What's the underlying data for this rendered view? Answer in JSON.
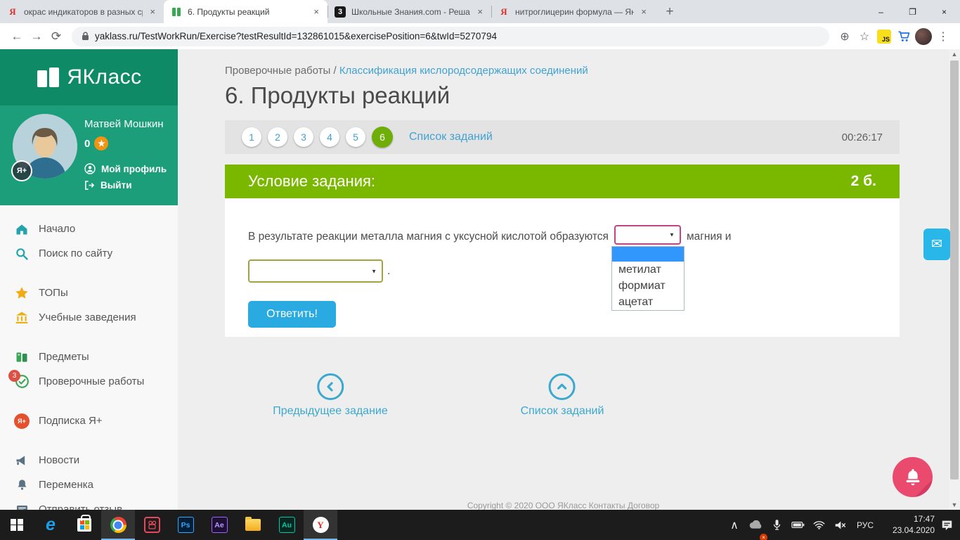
{
  "colors": {
    "sidebar_teal_dark": "#0e8a66",
    "sidebar_teal": "#1b9e79",
    "task_green": "#7ab800",
    "active_circle_green": "#6fae08",
    "link_blue": "#41a2d2",
    "button_blue": "#29abe2",
    "select1_border": "#c2457f",
    "select2_border": "#a2a43c",
    "dropdown_highlight": "#3297fd",
    "bell_pink": "#e94a6e",
    "mail_widget_blue": "#29b6e8",
    "badge_red": "#dd5145",
    "yaplus_red": "#e4512e"
  },
  "browser": {
    "tabs": [
      {
        "title": "окрас индикаторов в разных ср",
        "favicon_glyph": "Я"
      },
      {
        "title": "6. Продукты реакций",
        "favicon_glyph": ""
      },
      {
        "title": "Школьные Знания.com - Решае",
        "favicon_glyph": "3"
      },
      {
        "title": "нитроглицерин формула — Янд",
        "favicon_glyph": "Я"
      }
    ],
    "close_glyph": "×",
    "new_tab_glyph": "+",
    "window_controls": {
      "minimize": "–",
      "maximize": "❐",
      "close": "×"
    },
    "toolbar": {
      "back_glyph": "←",
      "forward_glyph": "→",
      "reload_glyph": "⟳",
      "url": "yaklass.ru/TestWorkRun/Exercise?testResultId=132861015&exercisePosition=6&twId=5270794",
      "zoom_glyph": "⊕",
      "star_glyph": "☆",
      "extension_label": "JS",
      "menu_glyph": "⋮"
    }
  },
  "sidebar": {
    "logo_text": "ЯКласс",
    "user": {
      "name": "Матвей Мошкин",
      "points": "0",
      "star_glyph": "★",
      "plus_badge": "Я+",
      "profile_label": "Мой профиль",
      "logout_label": "Выйти"
    },
    "menu": [
      {
        "label": "Начало"
      },
      {
        "label": "Поиск по сайту"
      },
      {
        "label": "ТОПы"
      },
      {
        "label": "Учебные заведения"
      },
      {
        "label": "Предметы"
      },
      {
        "label": "Проверочные работы",
        "badge": "3"
      },
      {
        "label": "Подписка Я+",
        "icon_text": "Я+"
      },
      {
        "label": "Новости"
      },
      {
        "label": "Переменка"
      },
      {
        "label": "Отправить отзыв"
      }
    ]
  },
  "main": {
    "breadcrumb": {
      "parent": "Проверочные работы",
      "separator": "/",
      "current": "Классификация кислородсодержащих соединений"
    },
    "title": "6. Продукты реакций",
    "exercise_nav": {
      "numbers": [
        "1",
        "2",
        "3",
        "4",
        "5",
        "6"
      ],
      "active_number": "6",
      "list_link": "Список заданий",
      "timer": "00:26:17"
    },
    "task": {
      "header": "Условие задания:",
      "points": "2 б.",
      "question_before": "В результате реакции металла магния с уксусной кислотой образуются",
      "question_middle": "магния и",
      "question_end": ".",
      "select_arrow_glyph": "▼",
      "dropdown_options": [
        "метилат",
        "формиат",
        "ацетат"
      ],
      "submit_label": "Ответить!"
    },
    "bottom_nav": {
      "prev_label": "Предыдущее задание",
      "list_label": "Список заданий"
    },
    "footer": "Copyright © 2020 ООО ЯКласс Контакты Договор"
  },
  "widgets": {
    "mail_glyph": "✉"
  },
  "taskbar": {
    "tray": {
      "chevron_glyph": "∧",
      "lang": "РУС",
      "time": "17:47",
      "date": "23.04.2020",
      "cloud_x_glyph": "×"
    },
    "scroll": {
      "up_glyph": "▲",
      "down_glyph": "▼"
    }
  }
}
